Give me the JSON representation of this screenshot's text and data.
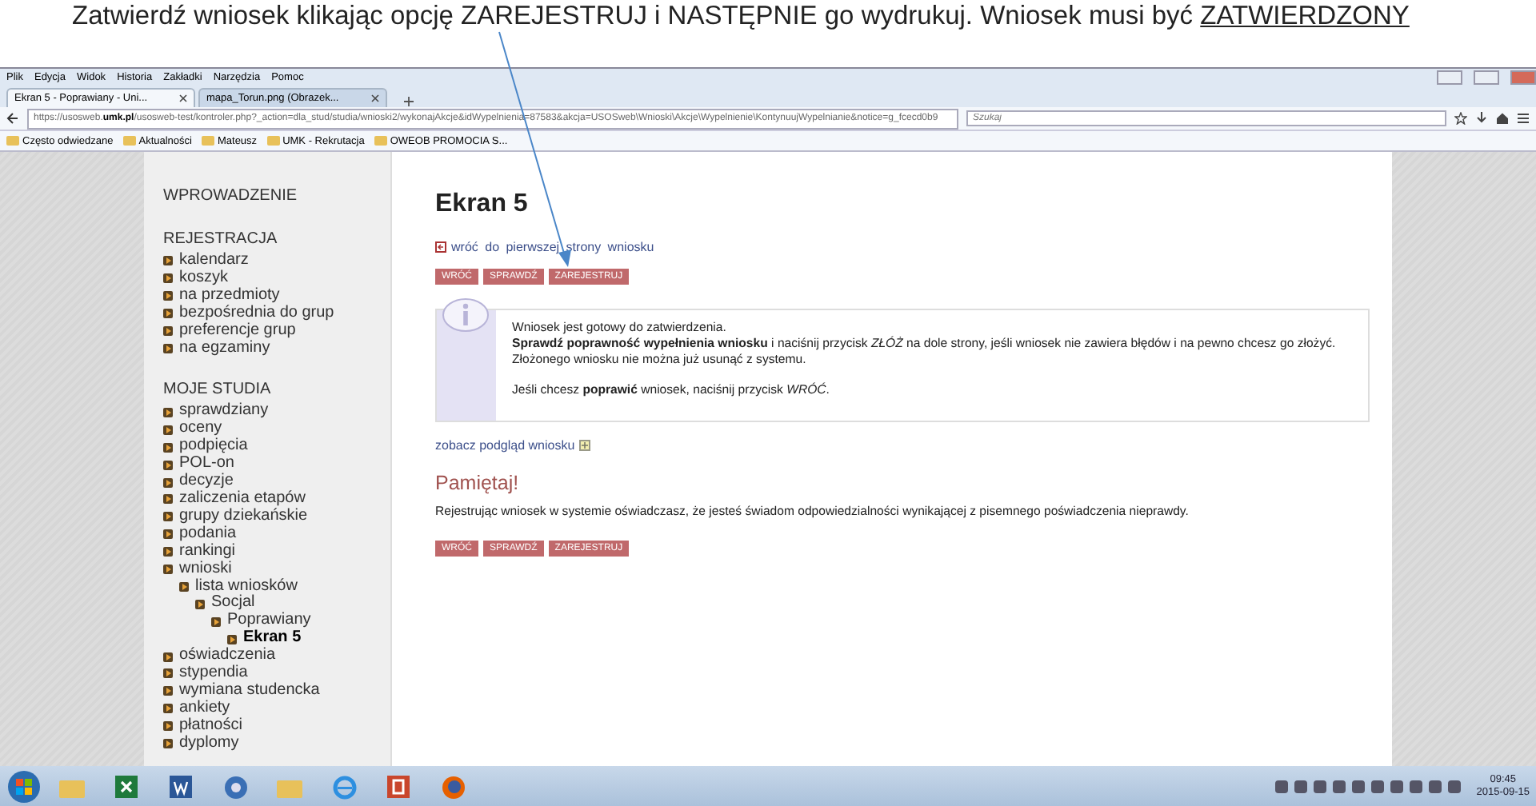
{
  "caption": {
    "text": "Zatwierdź wniosek klikając opcję ZAREJESTRUJ i NASTĘPNIE go wydrukuj. Wniosek musi być",
    "emphasis": "ZATWIERDZONY"
  },
  "browser": {
    "menu": [
      "Plik",
      "Edycja",
      "Widok",
      "Historia",
      "Zakładki",
      "Narzędzia",
      "Pomoc"
    ],
    "tabs": [
      {
        "label": "Ekran 5 - Poprawiany - Uni...",
        "selected": true
      },
      {
        "label": "mapa_Torun.png (Obrazek...",
        "selected": false
      }
    ],
    "url": "https://usosweb.**umk.pl**/usosweb-test/kontroler.php?_action=dla_stud/studia/wnioski2/wykonajAkcje&idWypelnienia=87583&akcja=USOSweb\\Wnioski\\Akcje\\Wypelnienie\\KontynuujWypelnianie&notice=g_fcecd0b9",
    "search": {
      "placeholder": "Szukaj"
    },
    "bookmarks": [
      "Często odwiedzane",
      "Aktualności",
      "Mateusz",
      "UMK - Rekrutacja",
      "OWEOB PROMOCIA S..."
    ]
  },
  "sidebar": [
    {
      "heading": "WPROWADZENIE"
    },
    {
      "heading": "REJESTRACJA",
      "items": [
        {
          "label": "kalendarz",
          "selected": false
        },
        {
          "label": "koszyk",
          "selected": false
        },
        {
          "label": "na przedmioty",
          "selected": false
        },
        {
          "label": "bezpośrednia do grup",
          "selected": false
        },
        {
          "label": "preferencje grup",
          "selected": false
        },
        {
          "label": "na egzaminy",
          "selected": false
        }
      ]
    },
    {
      "heading": "MOJE STUDIA",
      "items": [
        {
          "label": "sprawdziany",
          "selected": false
        },
        {
          "label": "oceny",
          "selected": false
        },
        {
          "label": "podpięcia",
          "selected": false
        },
        {
          "label": "POL-on",
          "selected": false
        },
        {
          "label": "decyzje",
          "selected": false
        },
        {
          "label": "zaliczenia etapów",
          "selected": false
        },
        {
          "label": "grupy dziekańskie",
          "selected": false
        },
        {
          "label": "podania",
          "selected": false
        },
        {
          "label": "rankingi",
          "selected": false
        },
        {
          "label": "wnioski",
          "selected": false,
          "children": [
            {
              "label": "lista wniosków",
              "selected": false,
              "children": [
                {
                  "label": "Socjal",
                  "selected": false,
                  "children": [
                    {
                      "label": "Poprawiany",
                      "selected": false,
                      "children": [
                        {
                          "label": "Ekran 5",
                          "selected": true
                        }
                      ]
                    }
                  ]
                }
              ]
            }
          ]
        },
        {
          "label": "oświadczenia",
          "selected": false
        },
        {
          "label": "stypendia",
          "selected": false
        },
        {
          "label": "wymiana studencka",
          "selected": false
        },
        {
          "label": "ankiety",
          "selected": false
        },
        {
          "label": "płatności",
          "selected": false
        },
        {
          "label": "dyplomy",
          "selected": false
        }
      ]
    }
  ],
  "content": {
    "title": "Ekran 5",
    "back_link": "wróć do pierwszej strony wniosku",
    "buttons_top": [
      "WRÓĆ",
      "SPRAWDŹ",
      "ZAREJESTRUJ"
    ],
    "info": {
      "paragraphs": [
        "Wniosek jest gotowy do zatwierdzenia.",
        "**Sprawdź poprawność wypełnienia wniosku** i naciśnij przycisk *ZŁÓŻ* na dole strony, jeśli wniosek nie zawiera błędów i na pewno chcesz go złożyć.",
        "Złożonego wniosku nie można już usunąć z systemu."
      ],
      "note": "Jeśli chcesz **poprawić** wniosek, naciśnij przycisk *WRÓĆ*."
    },
    "preview_link": "zobacz podgląd wniosku",
    "remember_heading": "Pamiętaj!",
    "remember_text": "Rejestrując wniosek w systemie oświadczasz, że jesteś świadom odpowiedzialności wynikającej z pisemnego poświadczenia nieprawdy.",
    "buttons_bottom": [
      "WRÓĆ",
      "SPRAWDŹ",
      "ZAREJESTRUJ"
    ]
  },
  "taskbar": {
    "time": "09:45",
    "date": "2015-09-15"
  }
}
